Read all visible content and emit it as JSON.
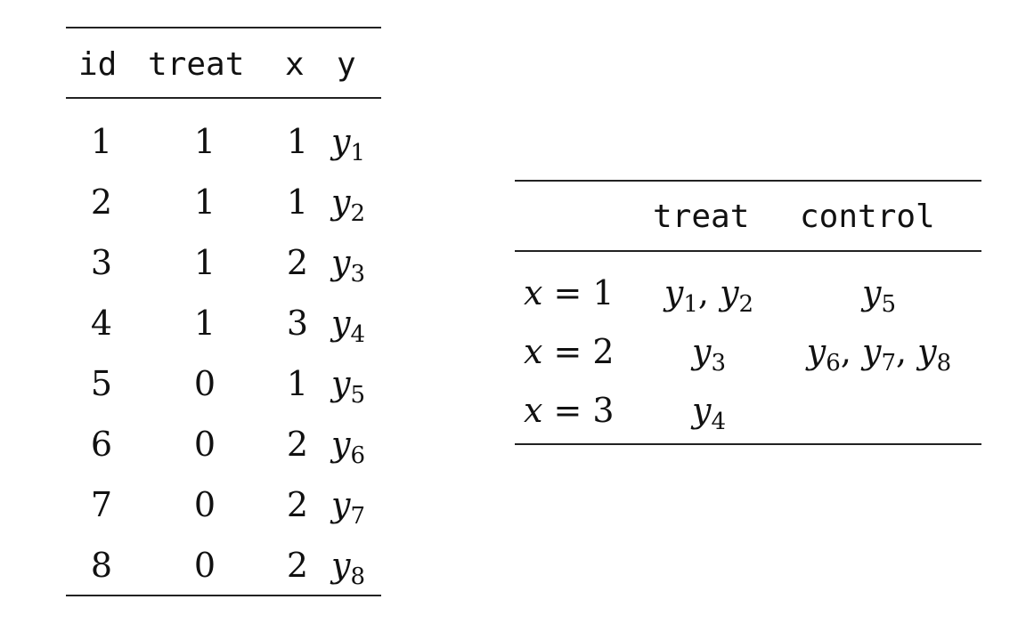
{
  "table1": {
    "headers": [
      "id",
      "treat",
      "x",
      "y"
    ],
    "rows": [
      {
        "id": "1",
        "treat": "1",
        "x": "1",
        "y_sym": "y",
        "y_sub": "1"
      },
      {
        "id": "2",
        "treat": "1",
        "x": "1",
        "y_sym": "y",
        "y_sub": "2"
      },
      {
        "id": "3",
        "treat": "1",
        "x": "2",
        "y_sym": "y",
        "y_sub": "3"
      },
      {
        "id": "4",
        "treat": "1",
        "x": "3",
        "y_sym": "y",
        "y_sub": "4"
      },
      {
        "id": "5",
        "treat": "0",
        "x": "1",
        "y_sym": "y",
        "y_sub": "5"
      },
      {
        "id": "6",
        "treat": "0",
        "x": "2",
        "y_sym": "y",
        "y_sub": "6"
      },
      {
        "id": "7",
        "treat": "0",
        "x": "2",
        "y_sym": "y",
        "y_sub": "7"
      },
      {
        "id": "8",
        "treat": "0",
        "x": "2",
        "y_sym": "y",
        "y_sub": "8"
      }
    ]
  },
  "table2": {
    "headers": [
      "treat",
      "control"
    ],
    "rows": [
      {
        "label_var": "x",
        "label_eq": " = 1",
        "treat": [
          "1",
          "2"
        ],
        "control": [
          "5"
        ]
      },
      {
        "label_var": "x",
        "label_eq": " = 2",
        "treat": [
          "3"
        ],
        "control": [
          "6",
          "7",
          "8"
        ]
      },
      {
        "label_var": "x",
        "label_eq": " = 3",
        "treat": [
          "4"
        ],
        "control": []
      }
    ],
    "symbol": "y",
    "separator": ", "
  }
}
